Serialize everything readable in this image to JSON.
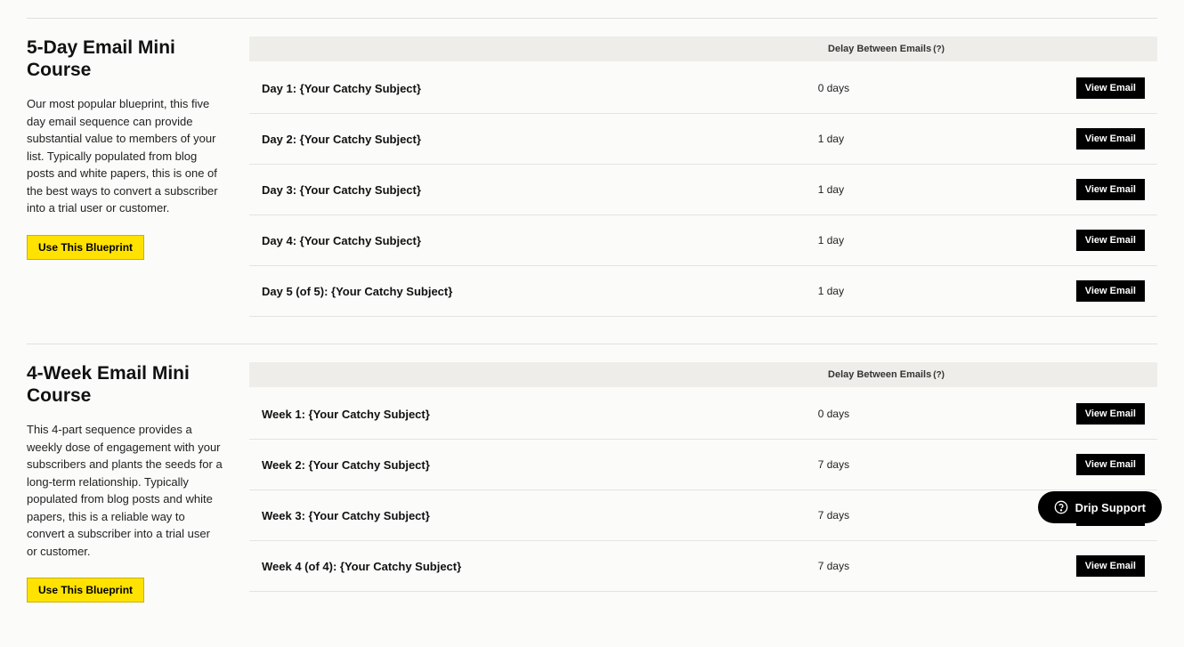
{
  "sections": [
    {
      "title": "5-Day Email Mini Course",
      "description": "Our most popular blueprint, this five day email sequence can provide substantial value to members of your list. Typically populated from blog posts and white papers, this is one of the best ways to convert a subscriber into a trial user or customer.",
      "use_button_label": "Use This Blueprint",
      "header_delay_label": "Delay Between Emails",
      "help_tooltip": "(?)",
      "rows": [
        {
          "subject": "Day 1: {Your Catchy Subject}",
          "delay": "0 days",
          "button": "View Email"
        },
        {
          "subject": "Day 2: {Your Catchy Subject}",
          "delay": "1 day",
          "button": "View Email"
        },
        {
          "subject": "Day 3: {Your Catchy Subject}",
          "delay": "1 day",
          "button": "View Email"
        },
        {
          "subject": "Day 4: {Your Catchy Subject}",
          "delay": "1 day",
          "button": "View Email"
        },
        {
          "subject": "Day 5 (of 5): {Your Catchy Subject}",
          "delay": "1 day",
          "button": "View Email"
        }
      ]
    },
    {
      "title": "4-Week Email Mini Course",
      "description": "This 4-part sequence provides a weekly dose of engagement with your subscribers and plants the seeds for a long-term relationship. Typically populated from blog posts and white papers, this is a reliable way to convert a subscriber into a trial user or customer.",
      "use_button_label": "Use This Blueprint",
      "header_delay_label": "Delay Between Emails",
      "help_tooltip": "(?)",
      "rows": [
        {
          "subject": "Week 1: {Your Catchy Subject}",
          "delay": "0 days",
          "button": "View Email"
        },
        {
          "subject": "Week 2: {Your Catchy Subject}",
          "delay": "7 days",
          "button": "View Email"
        },
        {
          "subject": "Week 3: {Your Catchy Subject}",
          "delay": "7 days",
          "button": "View Email"
        },
        {
          "subject": "Week 4 (of 4): {Your Catchy Subject}",
          "delay": "7 days",
          "button": "View Email"
        }
      ]
    }
  ],
  "support_widget_label": "Drip Support"
}
